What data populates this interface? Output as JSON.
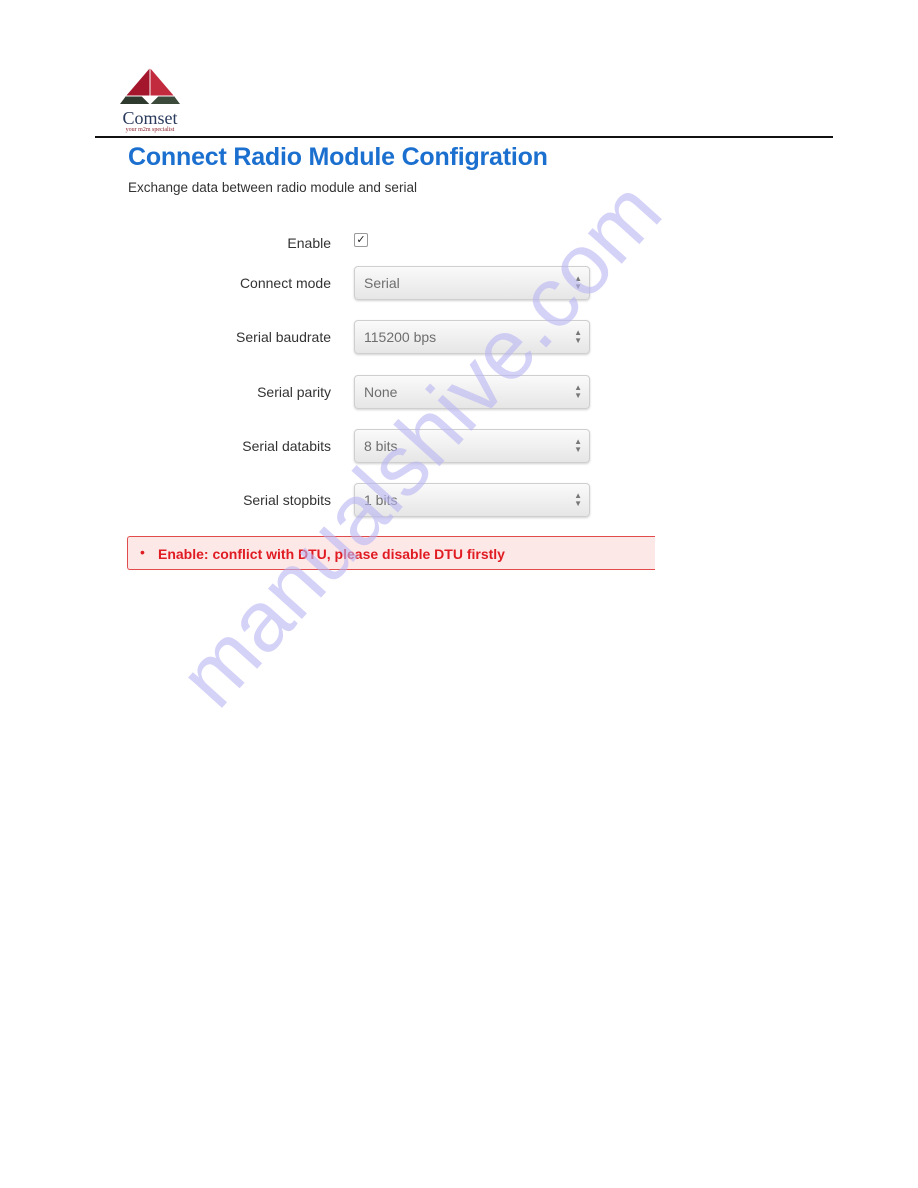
{
  "document_header": {
    "logo": {
      "name": "Comset",
      "tagline": "your m2m specialist",
      "colors": {
        "top": "#a3162c",
        "bottom": "#2e3a2e"
      }
    }
  },
  "screenshot": {
    "title": "Connect Radio Module Configration",
    "subtitle": "Exchange data between radio module and serial",
    "fields": [
      {
        "label": "Enable",
        "type": "checkbox",
        "checked": true,
        "value": "✓"
      },
      {
        "label": "Connect mode",
        "type": "select",
        "value": "Serial"
      },
      {
        "label": "Serial baudrate",
        "type": "select",
        "value": "115200 bps"
      },
      {
        "label": "Serial parity",
        "type": "select",
        "value": "None"
      },
      {
        "label": "Serial databits",
        "type": "select",
        "value": "8 bits"
      },
      {
        "label": "Serial stopbits",
        "type": "select",
        "value": "1 bits"
      }
    ],
    "select_arrows": "▲▼",
    "error": {
      "bullet": "•",
      "message": "Enable: conflict with DTU, please disable DTU firstly",
      "color": "#e01b22"
    }
  },
  "watermark": "manualshive.com"
}
